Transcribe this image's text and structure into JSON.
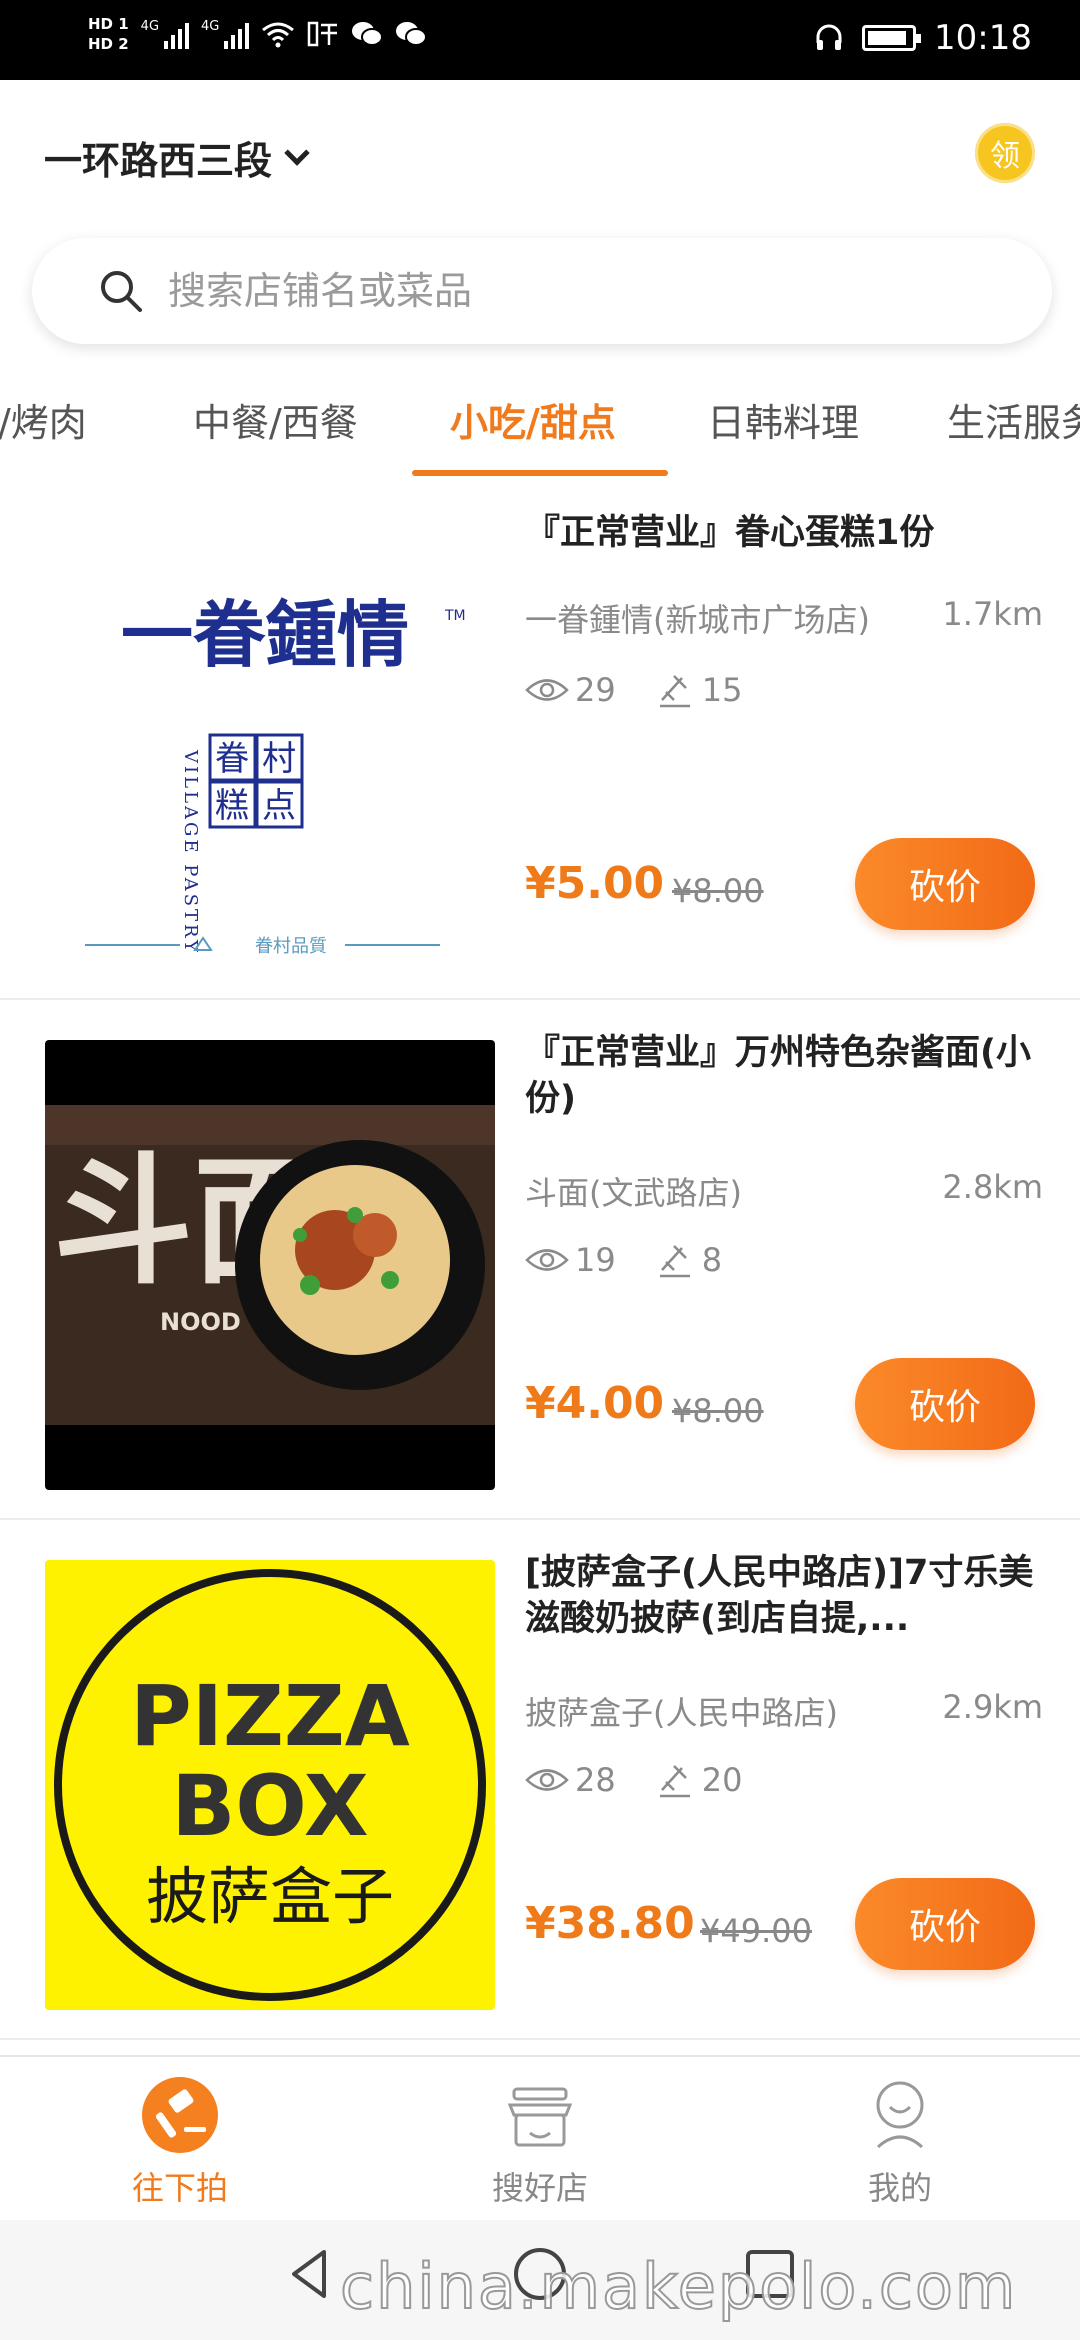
{
  "status_bar": {
    "hd1": "HD 1",
    "hd2": "HD 2",
    "net1": "4G",
    "net2": "4G",
    "time": "10:18"
  },
  "header": {
    "location": "一环路西三段",
    "coupon_label": "领"
  },
  "search": {
    "placeholder": "搜索店铺名或菜品"
  },
  "tabs": [
    {
      "label": "烤/烤肉"
    },
    {
      "label": "中餐/西餐"
    },
    {
      "label": "小吃/甜点"
    },
    {
      "label": "日韩料理"
    },
    {
      "label": "生活服务"
    }
  ],
  "active_tab": 2,
  "products": [
    {
      "title": "『正常营业』眷心蛋糕1份",
      "shop": "一眷鍾情(新城市广场店)",
      "distance": "1.7km",
      "views": "29",
      "bids": "15",
      "price": "¥5.00",
      "original_price": "¥8.00",
      "button": "砍价",
      "logo": {
        "brand": "一眷鍾情",
        "tm": "TM",
        "sub": [
          "眷",
          "村",
          "糕",
          "点"
        ],
        "english": "VILLAGE PASTRY",
        "tagline": "眷村品質"
      }
    },
    {
      "title": "『正常营业』万州特色杂酱面(小份)",
      "shop": "斗面(文武路店)",
      "distance": "2.8km",
      "views": "19",
      "bids": "8",
      "price": "¥4.00",
      "original_price": "¥8.00",
      "button": "砍价",
      "logo": {
        "brand": "斗面",
        "english": "NOOD"
      }
    },
    {
      "title": "[披萨盒子(人民中路店)]7寸乐美滋酸奶披萨(到店自提,...",
      "shop": "披萨盒子(人民中路店)",
      "distance": "2.9km",
      "views": "28",
      "bids": "20",
      "price": "¥38.80",
      "original_price": "¥49.00",
      "button": "砍价",
      "logo": {
        "line1": "PIZZA",
        "line2": "BOX",
        "line3": "披萨盒子"
      }
    }
  ],
  "bottom_nav": [
    {
      "label": "往下拍",
      "icon": "auction-hammer-icon",
      "active": true
    },
    {
      "label": "搜好店",
      "icon": "shop-icon",
      "active": false
    },
    {
      "label": "我的",
      "icon": "user-icon",
      "active": false
    }
  ],
  "watermark": "china.makepolo.com",
  "colors": {
    "accent": "#f07a1c",
    "coupon": "#f7c520",
    "pizza_yellow": "#fff200",
    "brand_blue": "#1f2f8f"
  }
}
